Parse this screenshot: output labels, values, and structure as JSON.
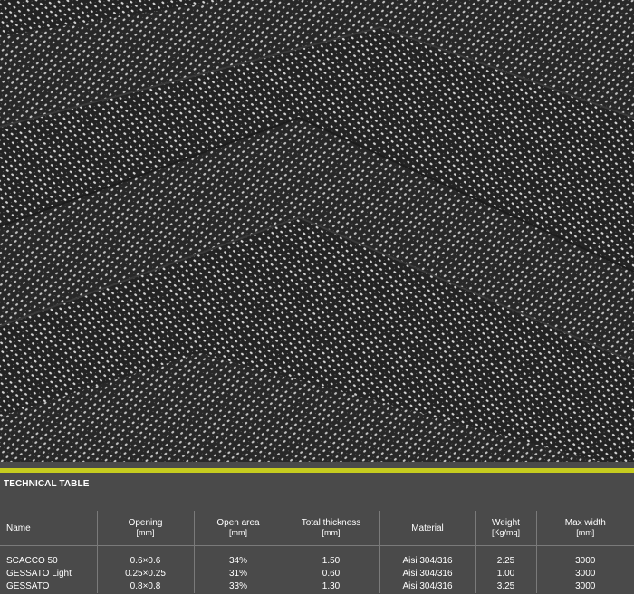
{
  "photo": {
    "subject": "herringbone-mesh-texture"
  },
  "colors": {
    "accent": "#c6cc1f",
    "panel_bg": "#4a4a4a",
    "divider": "#7a7a7a"
  },
  "table": {
    "title": "TECHNICAL TABLE",
    "columns": [
      {
        "label": "Name",
        "unit": ""
      },
      {
        "label": "Opening",
        "unit": "[mm]"
      },
      {
        "label": "Open area",
        "unit": "[mm]"
      },
      {
        "label": "Total thickness",
        "unit": "[mm]"
      },
      {
        "label": "Material",
        "unit": ""
      },
      {
        "label": "Weight",
        "unit": "[Kg/mq]"
      },
      {
        "label": "Max width",
        "unit": "[mm]"
      }
    ],
    "rows": [
      [
        "SCACCO 50",
        "0.6×0.6",
        "34%",
        "1.50",
        "Aisi 304/316",
        "2.25",
        "3000"
      ],
      [
        "GESSATO Light",
        "0.25×0.25",
        "31%",
        "0.60",
        "Aisi 304/316",
        "1.00",
        "3000"
      ],
      [
        "GESSATO",
        "0.8×0.8",
        "33%",
        "1.30",
        "Aisi 304/316",
        "3.25",
        "3000"
      ]
    ]
  }
}
